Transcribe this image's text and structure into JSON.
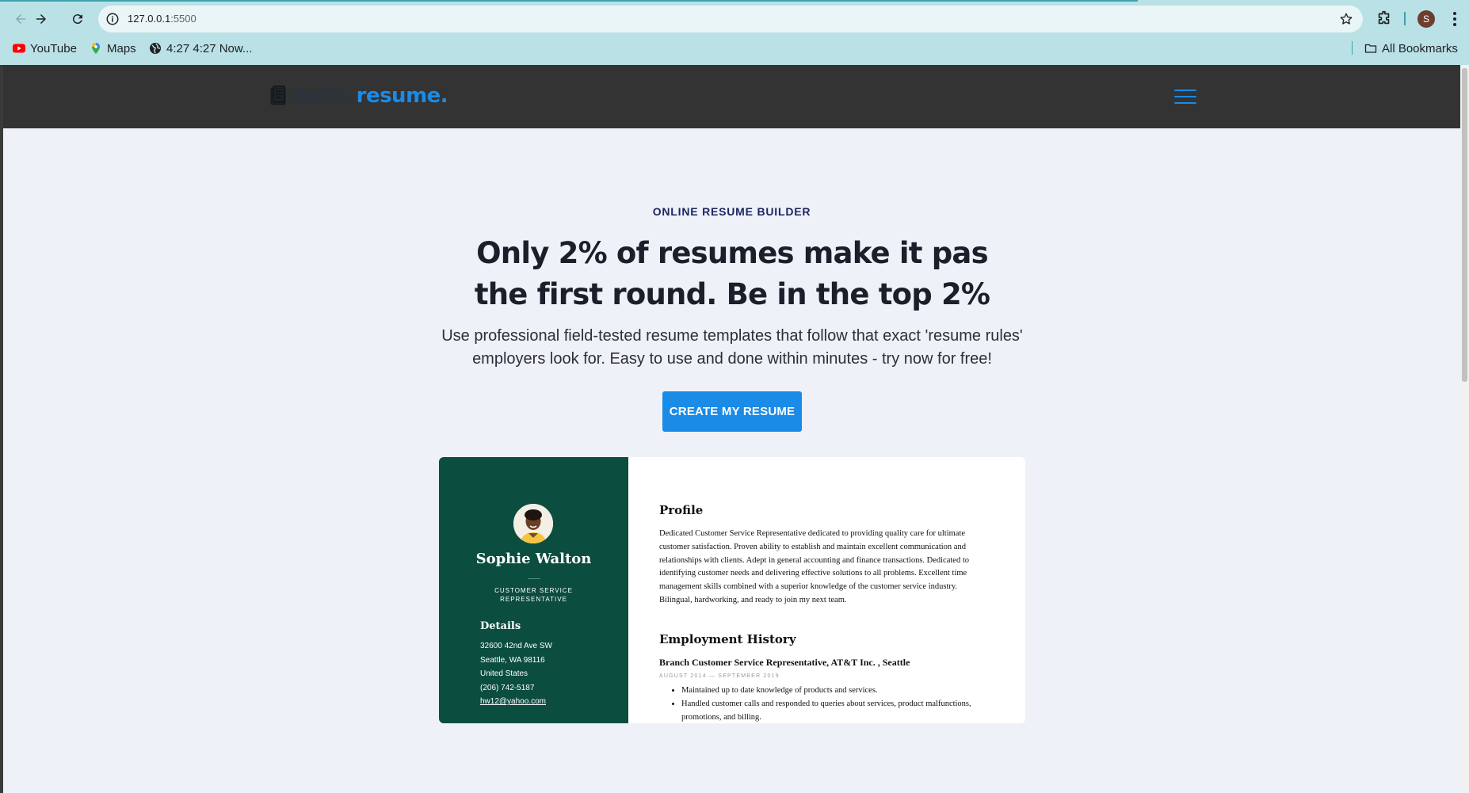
{
  "browser": {
    "url_host": "127.0.0.1",
    "url_port": ":5500",
    "profile_initial": "S",
    "bookmarks": [
      {
        "label": "YouTube",
        "icon": "youtube-icon"
      },
      {
        "label": "Maps",
        "icon": "maps-icon"
      },
      {
        "label": "4:27 4:27 Now...",
        "icon": "globe-icon"
      }
    ],
    "all_bookmarks_label": "All Bookmarks"
  },
  "header": {
    "logo_build": "build",
    "logo_resume": "resume.",
    "accent_color": "#1a8be6"
  },
  "hero": {
    "eyebrow": "ONLINE RESUME BUILDER",
    "headline": "Only 2% of resumes make it pas the first round. Be in the top 2%",
    "subtext": "Use professional field-tested resume templates that follow that exact 'resume rules' employers look for. Easy to use and done within minutes - try now for free!",
    "cta_label": "CREATE MY RESUME"
  },
  "resume": {
    "name": "Sophie Walton",
    "job_title": "CUSTOMER SERVICE REPRESENTATIVE",
    "details_heading": "Details",
    "details": {
      "address_line1": "32600 42nd Ave SW",
      "address_line2": "Seattle, WA 98116",
      "country": "United States",
      "phone": "(206) 742-5187",
      "email": "hw12@yahoo.com"
    },
    "profile_heading": "Profile",
    "profile_text": "Dedicated Customer Service Representative dedicated to providing quality care for ultimate customer satisfaction. Proven ability to establish and maintain excellent communication and relationships with clients. Adept in general accounting and finance transactions. Dedicated to identifying customer needs and delivering effective solutions to all problems. Excellent time management skills combined with a superior knowledge of the customer service industry. Bilingual, hardworking, and ready to join my next team.",
    "employment_heading": "Employment History",
    "job": {
      "title": "Branch Customer Service Representative, AT&T Inc. , Seattle",
      "dates": "AUGUST 2014 — SEPTEMBER 2019",
      "bullets": [
        "Maintained up to date knowledge of products and services.",
        "Handled customer calls and responded to queries about services, product malfunctions, promotions, and billing."
      ]
    },
    "sidebar_color": "#0b4d3f"
  }
}
